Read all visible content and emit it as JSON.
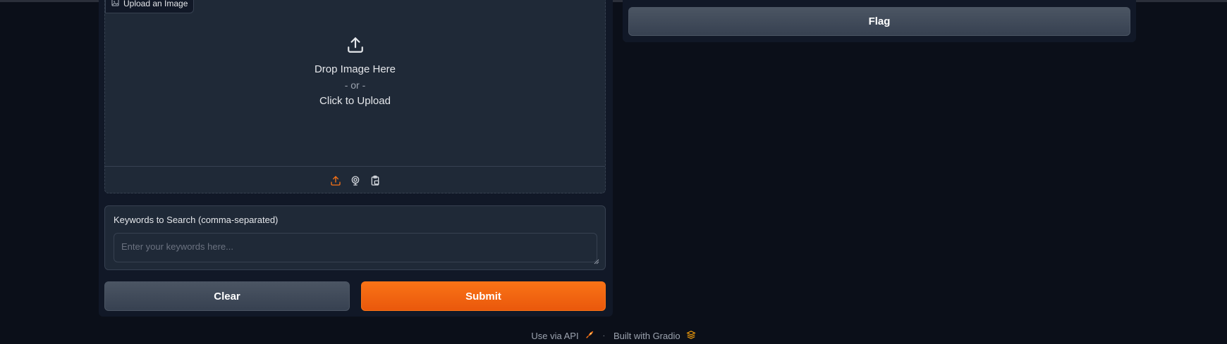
{
  "image_input": {
    "label": "Upload an Image",
    "drop_title": "Drop Image Here",
    "or_text": "- or -",
    "click_text": "Click to Upload",
    "sources": [
      {
        "name": "upload-source-icon",
        "active": true
      },
      {
        "name": "webcam-source-icon",
        "active": false
      },
      {
        "name": "clipboard-source-icon",
        "active": false
      }
    ]
  },
  "keywords": {
    "label": "Keywords to Search (comma-separated)",
    "placeholder": "Enter your keywords here...",
    "value": ""
  },
  "buttons": {
    "clear_label": "Clear",
    "submit_label": "Submit",
    "flag_label": "Flag"
  },
  "footer": {
    "api_label": "Use via API",
    "separator": "·",
    "built_label": "Built with Gradio"
  },
  "colors": {
    "background": "#0b0f19",
    "panel": "#111827",
    "block": "#1f2937",
    "accent": "#f97316",
    "secondary_button": "#4b5563"
  }
}
